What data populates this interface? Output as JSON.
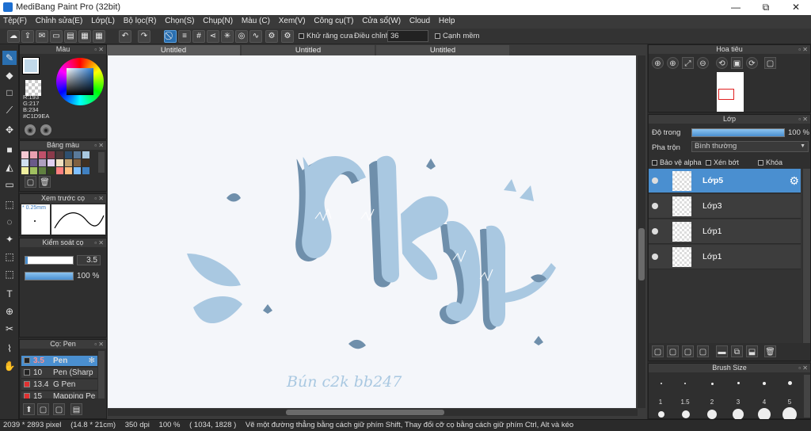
{
  "window": {
    "title": "MediBang Paint Pro (32bit)",
    "minimize": "—",
    "restore": "⧉",
    "close": "✕"
  },
  "menu": [
    "Tệp(F)",
    "Chỉnh sửa(E)",
    "Lớp(L)",
    "Bộ lọc(R)",
    "Chọn(S)",
    "Chụp(N)",
    "Màu (C)",
    "Xem(V)",
    "Công cụ(T)",
    "Cửa sổ(W)",
    "Cloud",
    "Help"
  ],
  "toolbar": {
    "antialias_label": "Khử răng cưa",
    "adjust_label": "Điều chỉnh",
    "adjust_value": "36",
    "smooth_label": "Cạnh mềm"
  },
  "tabs": [
    "Untitled",
    "Untitled",
    "Untitled"
  ],
  "color_panel": {
    "title": "Màu",
    "r": "R:193",
    "g": "G:217",
    "b": "B:234",
    "hex": "#C1D9EA",
    "current_color": "#c1d9ea"
  },
  "palette": {
    "title": "Bảng màu",
    "colors": [
      "#f4c9d2",
      "#e8a0b0",
      "#c0506a",
      "#8b3a4a",
      "#4a3a3a",
      "#2f4f6f",
      "#5a7a9a",
      "#a8c8e0",
      "#d0e0f0",
      "#6a5a8a",
      "#b0a0c0",
      "#e0d0f0",
      "#f0e0c0",
      "#c0a070",
      "#806040",
      "#403020",
      "#f0f0a0",
      "#a0c060",
      "#608040",
      "#304020",
      "#ff8080",
      "#ffc080",
      "#80c0ff",
      "#4080c0"
    ]
  },
  "brush_preview": {
    "title": "Xem trước cọ",
    "size": "* 0.25mm"
  },
  "brush_control": {
    "title": "Kiểm soát cọ",
    "size": "3.5",
    "opacity": "100 %"
  },
  "brush_list": {
    "title": "Cọ: Pen",
    "items": [
      {
        "size": "3.5",
        "name": "Pen",
        "color": "#222"
      },
      {
        "size": "10",
        "name": "Pen (Sharp",
        "color": "#222"
      },
      {
        "size": "13.4",
        "name": "G Pen",
        "color": "#e03030"
      },
      {
        "size": "15",
        "name": "Mapping Pe",
        "color": "#e03030"
      }
    ]
  },
  "navigator": {
    "title": "Hoa tiêu"
  },
  "layer_panel": {
    "title": "Lớp",
    "opacity_label": "Độ trong",
    "opacity_value": "100 %",
    "blend_label": "Pha trộn",
    "blend_value": "Bình thường",
    "protect_alpha": "Bảo vệ alpha",
    "clipping": "Xén bớt",
    "lock": "Khóa",
    "layers": [
      "Lớp5",
      "Lớp3",
      "Lớp1",
      "Lớp1"
    ]
  },
  "brush_size_panel": {
    "title": "Brush Size",
    "labels": [
      "1",
      "1.5",
      "2",
      "3",
      "4",
      "5"
    ]
  },
  "canvas": {
    "signature": "Bún c2k   bb247"
  },
  "status": {
    "pixels": "2039 * 2893 pixel",
    "cm": "(14.8 * 21cm)",
    "dpi": "350 dpi",
    "zoom": "100 %",
    "coords": "( 1034, 1828 )",
    "hint": "Vẽ một đường thẳng bằng cách giữ phím Shift, Thay đổi cỡ cọ bằng cách giữ phím Ctrl, Alt và kéo"
  }
}
